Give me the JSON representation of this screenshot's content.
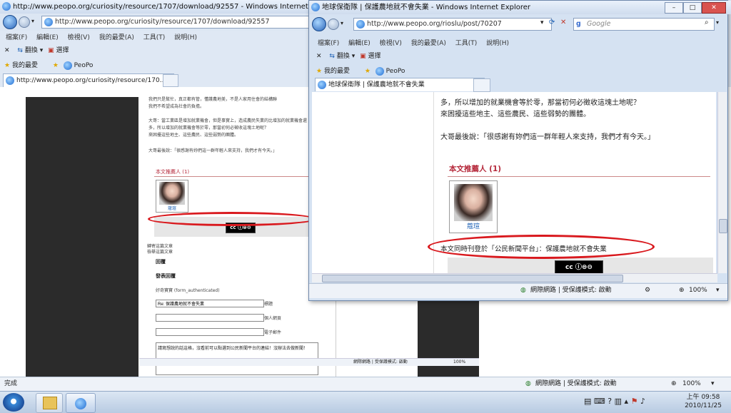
{
  "back_window": {
    "title": "http://www.peopo.org/curiosity/resource/1707/download/92557 - Windows Internet Explorer",
    "address": "http://www.peopo.org/curiosity/resource/1707/download/92557",
    "menu": [
      "檔案(F)",
      "編輯(E)",
      "檢視(V)",
      "我的最愛(A)",
      "工具(T)",
      "說明(H)"
    ],
    "toolbar": {
      "translate": "翻換",
      "select": "選擇"
    },
    "favorites": {
      "label": "我的最愛",
      "peopo": "PeoPo"
    },
    "tab_label": "http://www.peopo.org/curiosity/resource/170...",
    "content": {
      "line1": "我們只是幫忙，真正都有管，懂護農地美，不是人家用住會的結構聯",
      "line2": "我們不希望成為社會的負擔。",
      "para2": "大哥：當工業區是增加就業機會，但是事實上，造成農民失業的比增加的就業機會還",
      "para2b": "多，所以增加的就業機會等於零，那當初何必徵收這塊土地呢？",
      "para2c": "來困擾這些地主、這些農民、這些弱勢的團體。",
      "para3": "大哥最後說：「很感謝有妳們這一群年輕人來支持，我們才有今天。」",
      "recommender": "本文推薦人 (1)",
      "photo_name": "蔻瑄",
      "prev_link": "轉寄這篇文章",
      "next_link": "檢舉這篇文章",
      "reply": "回覆",
      "post_reply": "發表回覆",
      "user_label": "好奇寶寶 (form_authenticated)",
      "subject_value": "Re: 保護農地就不會失業",
      "subject_label": "標題",
      "homepage_label": "個人網頁",
      "email_label": "電子郵件",
      "textarea_text": "請寫想說的話這格，沒看前可以點選到公民新聞平台的連結！沒辦法去做新聞！"
    },
    "inner_status": {
      "zone": "網際網路 | 受保護模式: 啟動",
      "zoom": "100%"
    },
    "status_left": "完成",
    "status_zone": "網際網路 | 受保護模式: 啟動",
    "status_zoom": "100%"
  },
  "front_window": {
    "title": "地球保衛隊 | 保護農地就不會失業 - Windows Internet Explorer",
    "address": "http://www.peopo.org/rioslu/post/70207",
    "search_placeholder": "Google",
    "menu": [
      "檔案(F)",
      "編輯(E)",
      "檢視(V)",
      "我的最愛(A)",
      "工具(T)",
      "說明(H)"
    ],
    "toolbar": {
      "translate": "翻換",
      "select": "選擇"
    },
    "favorites": {
      "label": "我的最愛",
      "peopo": "PeoPo"
    },
    "tab_label": "地球保衛隊 | 保護農地就不會失業",
    "content": {
      "line1": "多，所以增加的就業機會等於零，那當初何必徵收這塊土地呢？",
      "line2": "來困擾這些地主、這些農民、這些弱勢的團體。",
      "quote": "大哥最後說：「很感謝有妳們這一群年輕人來支持，我們才有今天。」",
      "recommender": "本文推薦人 (1)",
      "photo_name": "蔻瑄",
      "also_published": "本文同時刊登於「公民新聞平台」：保護農地就不會失業"
    },
    "status_zone": "網際網路 | 受保護模式: 啟動",
    "status_zoom": "100%"
  },
  "taskbar": {
    "time": "上午 09:58",
    "date": "2010/11/25"
  },
  "colors": {
    "accent_red": "#b5283a",
    "ellipse_red": "#d9191e",
    "chrome_blue": "#cfdcee"
  }
}
